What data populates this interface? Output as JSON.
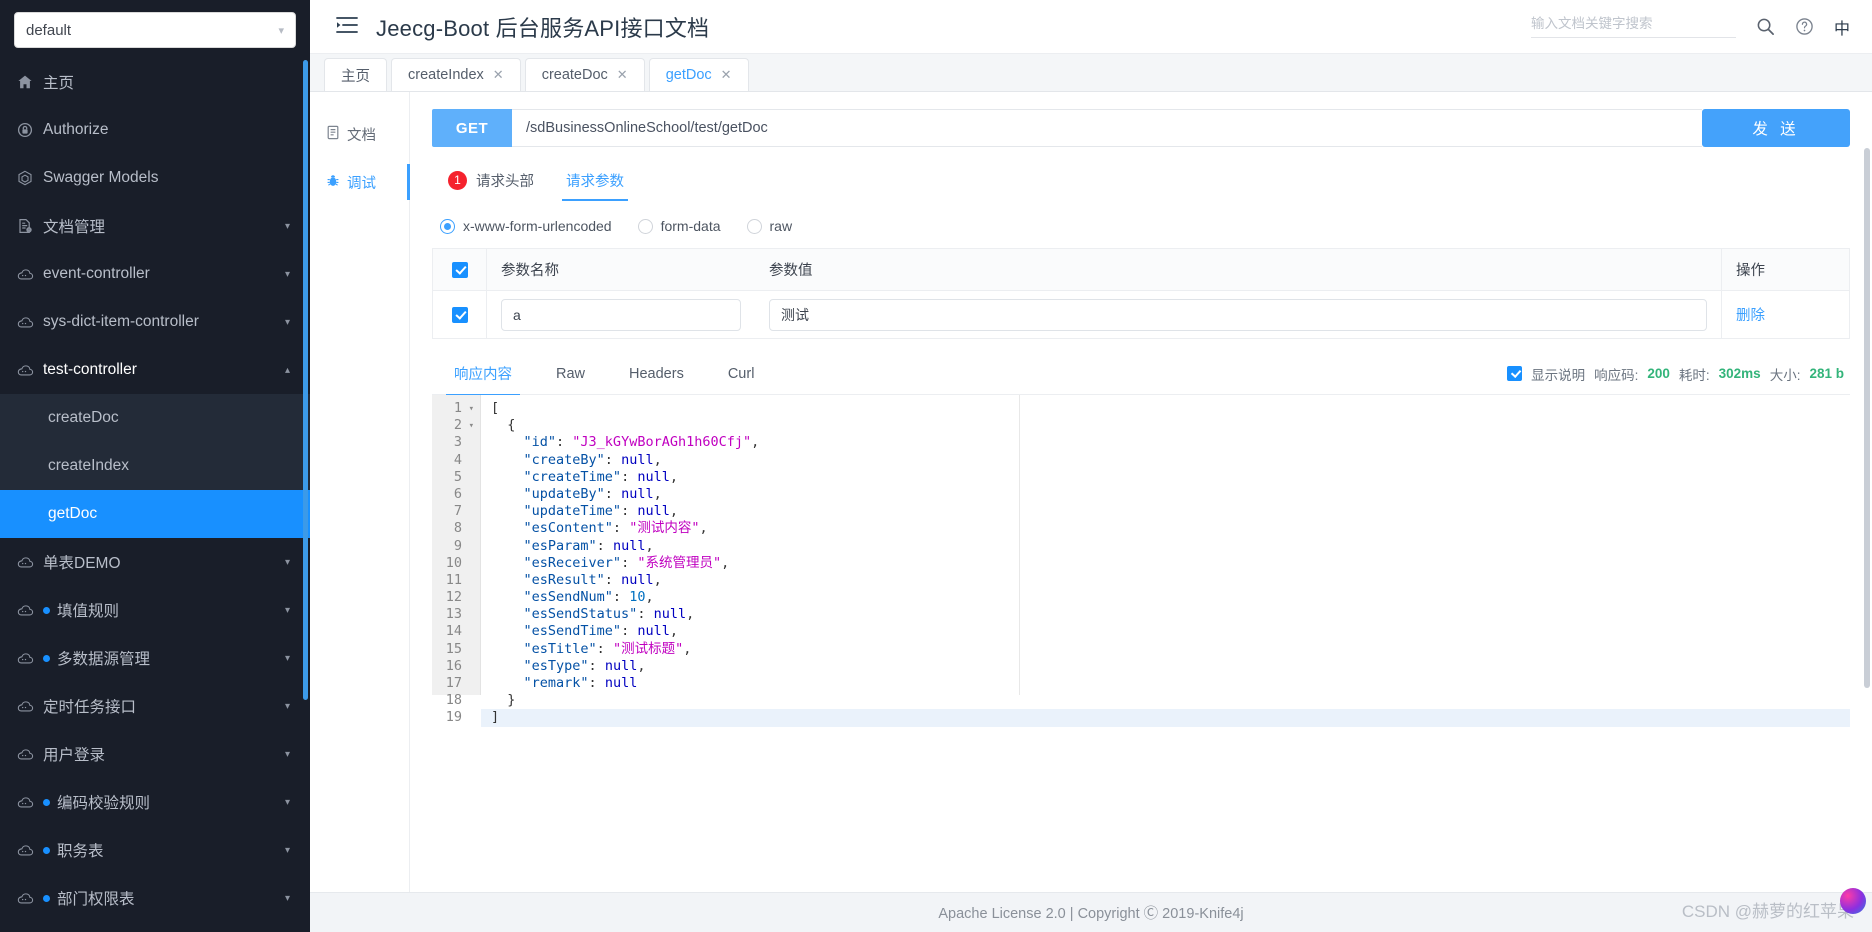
{
  "sidebar": {
    "service_select": {
      "value": "default",
      "icon": "chevron-down-icon"
    },
    "items": [
      {
        "label": "主页",
        "icon": "home-icon",
        "expandable": false,
        "dot": false,
        "strong": false
      },
      {
        "label": "Authorize",
        "icon": "lock-icon",
        "expandable": false,
        "dot": false,
        "strong": false
      },
      {
        "label": "Swagger Models",
        "icon": "models-icon",
        "expandable": false,
        "dot": false,
        "strong": false
      },
      {
        "label": "文档管理",
        "icon": "doc-icon",
        "expandable": true,
        "dot": false,
        "strong": false
      },
      {
        "label": "event-controller",
        "icon": "cloud-icon",
        "expandable": true,
        "dot": false,
        "strong": false
      },
      {
        "label": "sys-dict-item-controller",
        "icon": "cloud-icon",
        "expandable": true,
        "dot": false,
        "strong": false
      },
      {
        "label": "test-controller",
        "icon": "cloud-icon",
        "expandable": true,
        "dot": false,
        "strong": true,
        "expanded": true
      },
      {
        "label": "单表DEMO",
        "icon": "cloud-icon",
        "expandable": true,
        "dot": false,
        "strong": false
      },
      {
        "label": "填值规则",
        "icon": "cloud-icon",
        "expandable": true,
        "dot": true,
        "strong": false
      },
      {
        "label": "多数据源管理",
        "icon": "cloud-icon",
        "expandable": true,
        "dot": true,
        "strong": false
      },
      {
        "label": "定时任务接口",
        "icon": "cloud-icon",
        "expandable": true,
        "dot": false,
        "strong": false
      },
      {
        "label": "用户登录",
        "icon": "cloud-icon",
        "expandable": true,
        "dot": false,
        "strong": false
      },
      {
        "label": "编码校验规则",
        "icon": "cloud-icon",
        "expandable": true,
        "dot": true,
        "strong": false
      },
      {
        "label": "职务表",
        "icon": "cloud-icon",
        "expandable": true,
        "dot": true,
        "strong": false
      },
      {
        "label": "部门权限表",
        "icon": "cloud-icon",
        "expandable": true,
        "dot": true,
        "strong": false
      }
    ],
    "test_controller_children": [
      {
        "label": "createDoc",
        "active": false
      },
      {
        "label": "createIndex",
        "active": false
      },
      {
        "label": "getDoc",
        "active": true
      }
    ]
  },
  "header": {
    "menu_icon": "collapse-menu-icon",
    "title": "Jeecg-Boot 后台服务API接口文档",
    "search_placeholder": "输入文档关键字搜索",
    "search_value": "",
    "search_icon": "search-icon",
    "help_icon": "help-circle-icon",
    "lang_label": "中"
  },
  "tabs": [
    {
      "label": "主页",
      "closable": false,
      "active": false
    },
    {
      "label": "createIndex",
      "closable": true,
      "active": false
    },
    {
      "label": "createDoc",
      "closable": true,
      "active": false
    },
    {
      "label": "getDoc",
      "closable": true,
      "active": true
    }
  ],
  "vtabs": [
    {
      "label": "文档",
      "icon": "document-icon",
      "active": false
    },
    {
      "label": "调试",
      "icon": "bug-icon",
      "active": true
    }
  ],
  "request": {
    "method": "GET",
    "url": "/sdBusinessOnlineSchool/test/getDoc",
    "send_label": "发 送",
    "sub_tabs": [
      {
        "label": "请求头部",
        "badge": "1",
        "active": false
      },
      {
        "label": "请求参数",
        "badge": null,
        "active": true
      }
    ],
    "content_types": [
      {
        "label": "x-www-form-urlencoded",
        "selected": true
      },
      {
        "label": "form-data",
        "selected": false
      },
      {
        "label": "raw",
        "selected": false
      }
    ],
    "table": {
      "header_checkbox_checked": true,
      "columns": [
        "参数名称",
        "参数值",
        "操作"
      ],
      "rows": [
        {
          "checked": true,
          "name": "a",
          "value": "测试",
          "action": "删除"
        }
      ]
    }
  },
  "response": {
    "tabs": [
      {
        "label": "响应内容",
        "active": true
      },
      {
        "label": "Raw",
        "active": false
      },
      {
        "label": "Headers",
        "active": false
      },
      {
        "label": "Curl",
        "active": false
      }
    ],
    "show_desc": {
      "label": "显示说明",
      "checked": true
    },
    "status_code_label": "响应码:",
    "status_code_value": "200",
    "time_label": "耗时:",
    "time_value": "302ms",
    "size_label": "大小:",
    "size_value": "281 b",
    "body_lines": [
      {
        "n": 1,
        "fold": true,
        "indent": 0,
        "tokens": [
          [
            "pn",
            "["
          ]
        ]
      },
      {
        "n": 2,
        "fold": true,
        "indent": 1,
        "tokens": [
          [
            "pn",
            "{"
          ]
        ]
      },
      {
        "n": 3,
        "fold": false,
        "indent": 2,
        "tokens": [
          [
            "s",
            "\"id\""
          ],
          [
            "pn",
            ": "
          ],
          [
            "sc",
            "\"J3_kGYwBorAGh1h60Cfj\""
          ],
          [
            "pn",
            ","
          ]
        ]
      },
      {
        "n": 4,
        "fold": false,
        "indent": 2,
        "tokens": [
          [
            "s",
            "\"createBy\""
          ],
          [
            "pn",
            ": "
          ],
          [
            "kw",
            "null"
          ],
          [
            "pn",
            ","
          ]
        ]
      },
      {
        "n": 5,
        "fold": false,
        "indent": 2,
        "tokens": [
          [
            "s",
            "\"createTime\""
          ],
          [
            "pn",
            ": "
          ],
          [
            "kw",
            "null"
          ],
          [
            "pn",
            ","
          ]
        ]
      },
      {
        "n": 6,
        "fold": false,
        "indent": 2,
        "tokens": [
          [
            "s",
            "\"updateBy\""
          ],
          [
            "pn",
            ": "
          ],
          [
            "kw",
            "null"
          ],
          [
            "pn",
            ","
          ]
        ]
      },
      {
        "n": 7,
        "fold": false,
        "indent": 2,
        "tokens": [
          [
            "s",
            "\"updateTime\""
          ],
          [
            "pn",
            ": "
          ],
          [
            "kw",
            "null"
          ],
          [
            "pn",
            ","
          ]
        ]
      },
      {
        "n": 8,
        "fold": false,
        "indent": 2,
        "tokens": [
          [
            "s",
            "\"esContent\""
          ],
          [
            "pn",
            ": "
          ],
          [
            "sc",
            "\"测试内容\""
          ],
          [
            "pn",
            ","
          ]
        ]
      },
      {
        "n": 9,
        "fold": false,
        "indent": 2,
        "tokens": [
          [
            "s",
            "\"esParam\""
          ],
          [
            "pn",
            ": "
          ],
          [
            "kw",
            "null"
          ],
          [
            "pn",
            ","
          ]
        ]
      },
      {
        "n": 10,
        "fold": false,
        "indent": 2,
        "tokens": [
          [
            "s",
            "\"esReceiver\""
          ],
          [
            "pn",
            ": "
          ],
          [
            "sc",
            "\"系统管理员\""
          ],
          [
            "pn",
            ","
          ]
        ]
      },
      {
        "n": 11,
        "fold": false,
        "indent": 2,
        "tokens": [
          [
            "s",
            "\"esResult\""
          ],
          [
            "pn",
            ": "
          ],
          [
            "kw",
            "null"
          ],
          [
            "pn",
            ","
          ]
        ]
      },
      {
        "n": 12,
        "fold": false,
        "indent": 2,
        "tokens": [
          [
            "s",
            "\"esSendNum\""
          ],
          [
            "pn",
            ": "
          ],
          [
            "n",
            "10"
          ],
          [
            "pn",
            ","
          ]
        ]
      },
      {
        "n": 13,
        "fold": false,
        "indent": 2,
        "tokens": [
          [
            "s",
            "\"esSendStatus\""
          ],
          [
            "pn",
            ": "
          ],
          [
            "kw",
            "null"
          ],
          [
            "pn",
            ","
          ]
        ]
      },
      {
        "n": 14,
        "fold": false,
        "indent": 2,
        "tokens": [
          [
            "s",
            "\"esSendTime\""
          ],
          [
            "pn",
            ": "
          ],
          [
            "kw",
            "null"
          ],
          [
            "pn",
            ","
          ]
        ]
      },
      {
        "n": 15,
        "fold": false,
        "indent": 2,
        "tokens": [
          [
            "s",
            "\"esTitle\""
          ],
          [
            "pn",
            ": "
          ],
          [
            "sc",
            "\"测试标题\""
          ],
          [
            "pn",
            ","
          ]
        ]
      },
      {
        "n": 16,
        "fold": false,
        "indent": 2,
        "tokens": [
          [
            "s",
            "\"esType\""
          ],
          [
            "pn",
            ": "
          ],
          [
            "kw",
            "null"
          ],
          [
            "pn",
            ","
          ]
        ]
      },
      {
        "n": 17,
        "fold": false,
        "indent": 2,
        "tokens": [
          [
            "s",
            "\"remark\""
          ],
          [
            "pn",
            ": "
          ],
          [
            "kw",
            "null"
          ]
        ]
      },
      {
        "n": 18,
        "fold": false,
        "indent": 1,
        "tokens": [
          [
            "pn",
            "}"
          ]
        ]
      },
      {
        "n": 19,
        "fold": false,
        "indent": 0,
        "tokens": [
          [
            "pn",
            "]"
          ]
        ],
        "highlight": true
      }
    ]
  },
  "footer": {
    "text": "Apache License 2.0 | Copyright Ⓒ 2019-Knife4j"
  },
  "watermark": {
    "text": "CSDN @赫萝的红苹果"
  },
  "colors": {
    "accent": "#1890ff",
    "sidebar_bg": "#191e29",
    "method_get": "#5fb0fb",
    "success": "#33b47a",
    "danger": "#f5222d"
  }
}
